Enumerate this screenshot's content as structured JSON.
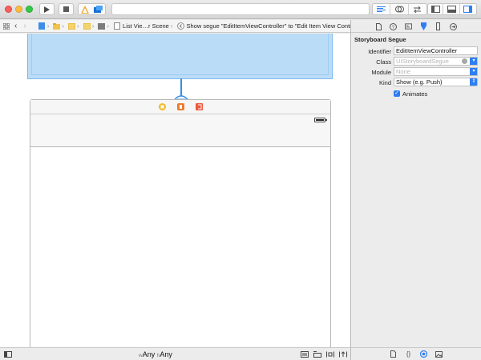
{
  "window": {
    "colors": {
      "close": "#fc605c",
      "minimize": "#fdbc40",
      "zoom": "#34c84a",
      "accent": "#2f7ef4",
      "selection": "#bbdcf7"
    }
  },
  "toolbar": {
    "run_icon": "play-icon",
    "stop_icon": "stop-icon",
    "scheme_icon": "xcode-scheme-icon",
    "device_icon": "ios-simulator-icon",
    "editor_modes": [
      "standard-editor-icon",
      "assistant-editor-icon",
      "version-editor-icon"
    ],
    "view_toggles": [
      "navigator-panel-icon",
      "debug-panel-icon",
      "utilities-panel-icon"
    ]
  },
  "jumpbar": {
    "items": [
      {
        "icon": "storyboard-file-icon"
      },
      {
        "icon": "folder-icon"
      },
      {
        "icon": "folder-yellow-icon"
      },
      {
        "icon": "group-icon"
      },
      {
        "icon": "storyboard-icon"
      },
      {
        "icon": "scene-icon",
        "label": "List Vie…r Scene"
      },
      {
        "icon": "segue-icon",
        "label": "Show segue \"EditItemViewController\" to \"Edit Item View Controller\""
      }
    ]
  },
  "canvas": {
    "scene_dock_icons": [
      "view-controller-icon",
      "first-responder-icon",
      "exit-icon"
    ]
  },
  "bottombar": {
    "width_prefix": "w",
    "width_value": "Any",
    "height_prefix": "h",
    "height_value": "Any",
    "right_icons": [
      "align-icon",
      "pin-icon",
      "resolve-issues-icon",
      "resizing-icon"
    ]
  },
  "inspector": {
    "tabs": [
      "file-inspector-icon",
      "quick-help-icon",
      "identity-inspector-icon",
      "attributes-inspector-icon",
      "size-inspector-icon",
      "connections-inspector-icon"
    ],
    "active_tab": 3,
    "section_title": "Storyboard Segue",
    "identifier": {
      "label": "Identifier",
      "value": "EditItemViewController"
    },
    "class": {
      "label": "Class",
      "placeholder": "UIStoryboardSegue"
    },
    "module": {
      "label": "Module",
      "placeholder": "None"
    },
    "kind": {
      "label": "Kind",
      "value": "Show (e.g. Push)"
    },
    "animates": {
      "label": "Animates",
      "checked": true
    },
    "library_tabs": [
      "file-template-library-icon",
      "code-snippet-library-icon",
      "object-library-icon",
      "media-library-icon"
    ]
  }
}
